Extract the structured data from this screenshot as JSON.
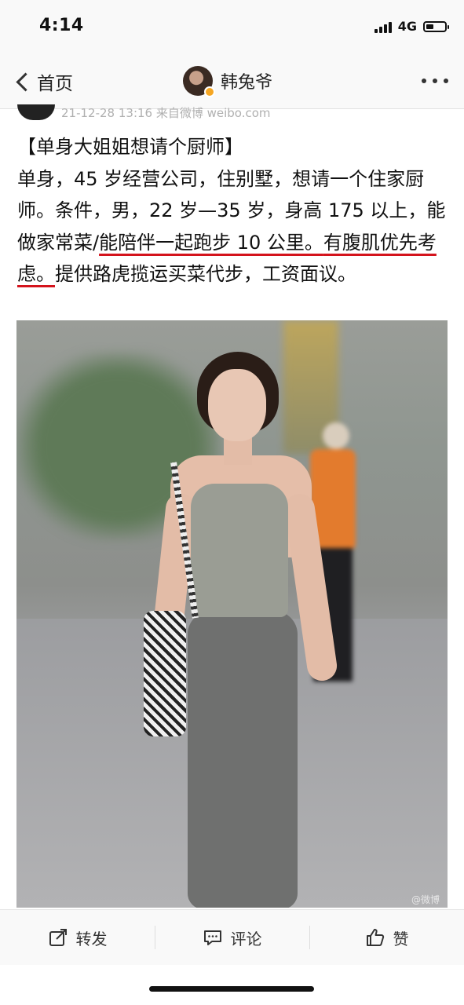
{
  "status_bar": {
    "time": "4:14",
    "network": "4G",
    "signal_icon": "signal-bars-icon",
    "battery_icon": "battery-icon",
    "battery_level": 0.4
  },
  "nav": {
    "back_label": "首页",
    "title": "韩兔爷",
    "back_icon": "chevron-left-icon",
    "more_icon": "more-dots-icon"
  },
  "post": {
    "meta": "21-12-28 13:16  来自微博 weibo.com",
    "title_line": "【单身大姐姐想请个厨师】",
    "body_part1": "单身，45 岁经营公司，住别墅，想请一个住家厨师。条件，男，22 岁—35 岁，身高 175 以上，能做家常菜/",
    "body_underlined_1": "能陪伴一起跑步 10 公里。",
    "body_underlined_2": "有腹肌优先考虑。",
    "body_part2": "提供路虎揽运买菜代步，工资面议。",
    "underline_color": "#d4131c"
  },
  "photo": {
    "watermark": "@微博"
  },
  "actions": {
    "repost_label": "转发",
    "comment_label": "评论",
    "like_label": "赞",
    "repost_icon": "share-arrow-icon",
    "comment_icon": "comment-bubble-icon",
    "like_icon": "thumbs-up-icon"
  }
}
